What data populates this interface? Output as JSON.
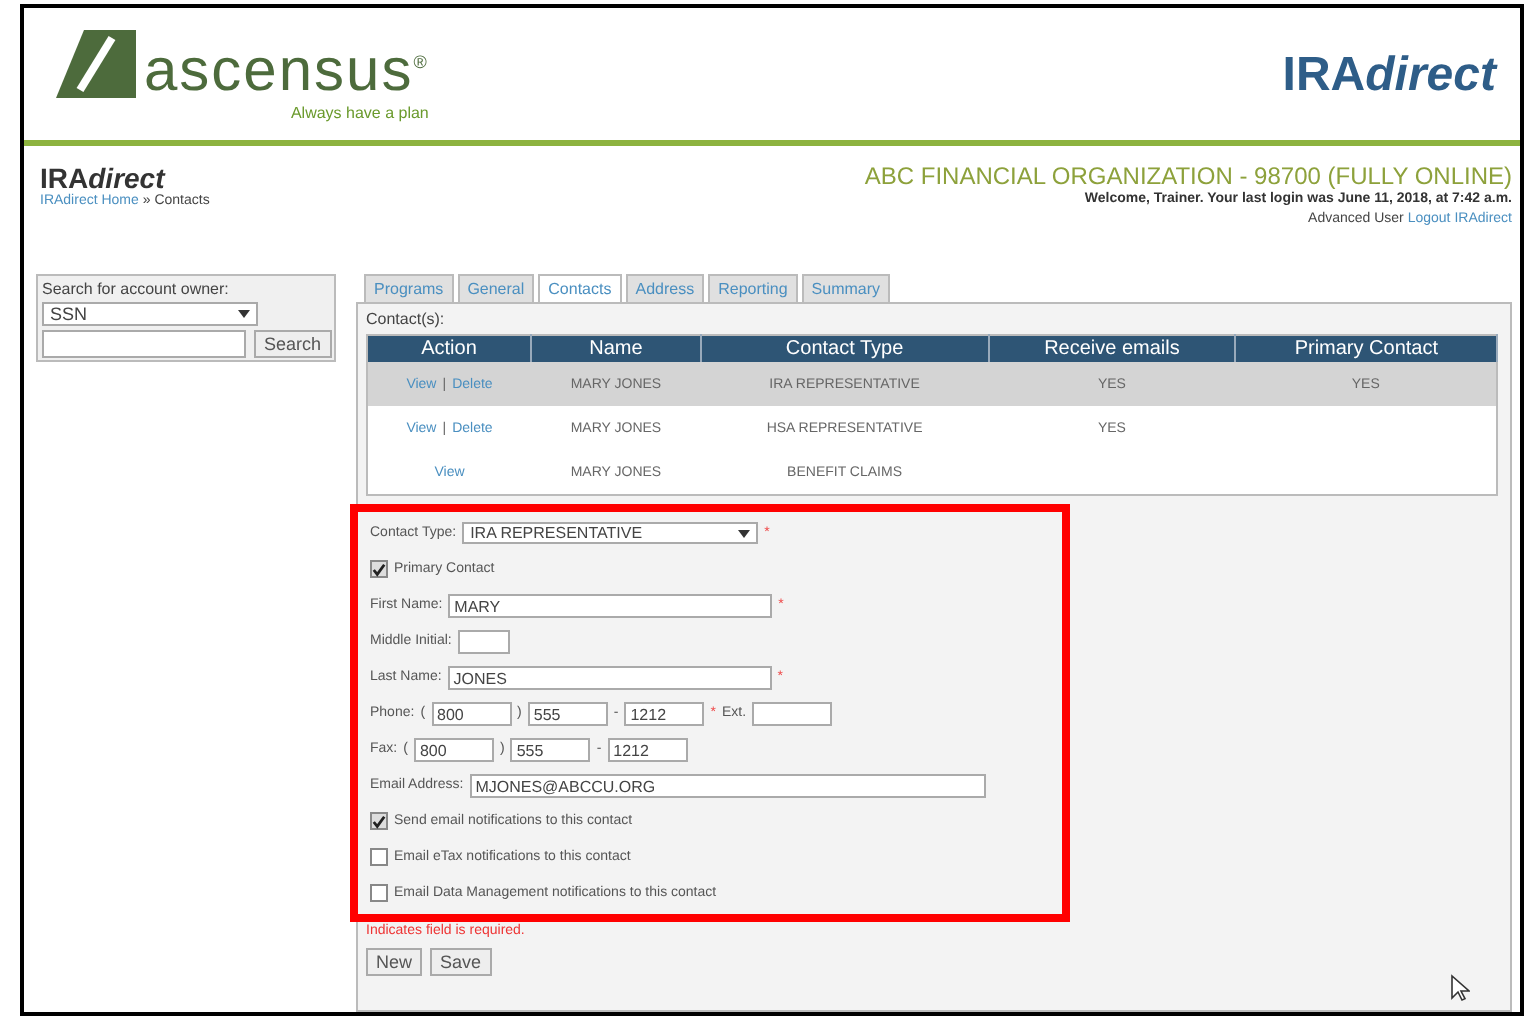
{
  "header": {
    "logo": {
      "name": "ascensus",
      "registered": "®",
      "tagline": "Always have a plan"
    },
    "brand": {
      "main": "IRA",
      "accent": "direct"
    }
  },
  "page": {
    "title": {
      "main": "IRA",
      "accent": "direct"
    },
    "breadcrumb_link": "IRAdirect Home",
    "breadcrumb_current": "» Contacts",
    "org": "ABC FINANCIAL ORGANIZATION - 98700 (FULLY ONLINE)",
    "welcome": "Welcome, Trainer. Your last login was June 11, 2018, at 7:42 a.m.",
    "role": "Advanced User",
    "logout": "Logout IRAdirect"
  },
  "search": {
    "label": "Search for account owner:",
    "select": "SSN",
    "button": "Search"
  },
  "tabs": [
    {
      "label": "Programs",
      "selected": false
    },
    {
      "label": "General",
      "selected": false
    },
    {
      "label": "Contacts",
      "selected": true
    },
    {
      "label": "Address",
      "selected": false
    },
    {
      "label": "Reporting",
      "selected": false
    },
    {
      "label": "Summary",
      "selected": false
    }
  ],
  "contacts_label": "Contact(s):",
  "table": {
    "columns": [
      "Action",
      "Name",
      "Contact Type",
      "Receive emails",
      "Primary Contact"
    ],
    "rows": [
      {
        "actions": [
          "View",
          "Delete"
        ],
        "separator": "|",
        "name": "MARY JONES",
        "type": "IRA REPRESENTATIVE",
        "emails": "YES",
        "primary": "YES",
        "selected": true
      },
      {
        "actions": [
          "View",
          "Delete"
        ],
        "separator": "|",
        "name": "MARY JONES",
        "type": "HSA REPRESENTATIVE",
        "emails": "YES",
        "selected": false
      },
      {
        "actions": [
          "View"
        ],
        "name": "MARY JONES",
        "type": "BENEFIT CLAIMS",
        "selected": false
      }
    ]
  },
  "form": [
    {
      "kind": "select",
      "label": "Contact Type:",
      "value": "IRA REPRESENTATIVE",
      "required_mark": "*"
    },
    {
      "kind": "checkbox",
      "label": "Primary Contact",
      "checked": true
    },
    {
      "kind": "text",
      "label": "First Name:",
      "value": "MARY",
      "required_mark": "*"
    },
    {
      "kind": "short_text",
      "label": "Middle Initial:"
    },
    {
      "kind": "text",
      "label": "Last Name:",
      "value": "JONES",
      "required_mark": "*"
    },
    {
      "kind": "inline",
      "label": "Phone:",
      "parts": [
        {
          "kind": "text",
          "text": "("
        },
        {
          "kind": "input",
          "value": "800"
        },
        {
          "kind": "text",
          "text": ")"
        },
        {
          "kind": "input",
          "value": "555"
        },
        {
          "kind": "text",
          "text": "-"
        },
        {
          "kind": "input",
          "value": "1212"
        },
        {
          "kind": "mark",
          "text": "*"
        },
        {
          "kind": "text",
          "text": "Ext."
        },
        {
          "kind": "input"
        }
      ]
    },
    {
      "kind": "inline",
      "label": "Fax:",
      "parts": [
        {
          "kind": "text",
          "text": "("
        },
        {
          "kind": "input",
          "value": "800"
        },
        {
          "kind": "text",
          "text": ")"
        },
        {
          "kind": "input",
          "value": "555"
        },
        {
          "kind": "text",
          "text": "-"
        },
        {
          "kind": "input",
          "value": "1212"
        }
      ]
    },
    {
      "kind": "wide_text",
      "label": "Email Address:",
      "value": "MJONES@ABCCU.ORG"
    },
    {
      "kind": "checkbox",
      "label": "Send email notifications to this contact",
      "checked": true
    },
    {
      "kind": "checkbox",
      "label": "Email eTax notifications to this contact",
      "checked": false
    },
    {
      "kind": "checkbox",
      "label": "Email Data Management notifications to this contact",
      "checked": false
    }
  ],
  "required_note": "Indicates field is required.",
  "buttons": [
    "New",
    "Save"
  ]
}
